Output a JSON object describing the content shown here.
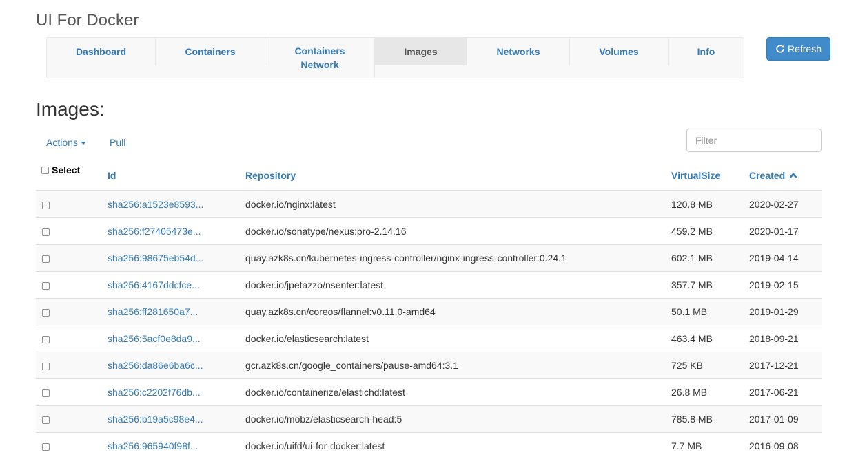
{
  "app_title": "UI For Docker",
  "nav": {
    "items": [
      {
        "label": "Dashboard"
      },
      {
        "label": "Containers"
      },
      {
        "label": "Containers Network"
      },
      {
        "label": "Images"
      },
      {
        "label": "Networks"
      },
      {
        "label": "Volumes"
      },
      {
        "label": "Info"
      }
    ],
    "active": "Images"
  },
  "refresh_label": "Refresh",
  "page_title": "Images:",
  "toolbar": {
    "actions_label": "Actions",
    "pull_label": "Pull",
    "filter_placeholder": "Filter"
  },
  "table": {
    "headers": {
      "select": "Select",
      "id": "Id",
      "repository": "Repository",
      "virtual_size": "VirtualSize",
      "created": "Created"
    },
    "sort_column": "Created",
    "rows": [
      {
        "id": "sha256:a1523e8593...",
        "repository": "docker.io/nginx:latest",
        "virtual_size": "120.8 MB",
        "created": "2020-02-27"
      },
      {
        "id": "sha256:f27405473e...",
        "repository": "docker.io/sonatype/nexus:pro-2.14.16",
        "virtual_size": "459.2 MB",
        "created": "2020-01-17"
      },
      {
        "id": "sha256:98675eb54d...",
        "repository": "quay.azk8s.cn/kubernetes-ingress-controller/nginx-ingress-controller:0.24.1",
        "virtual_size": "602.1 MB",
        "created": "2019-04-14"
      },
      {
        "id": "sha256:4167ddcfce...",
        "repository": "docker.io/jpetazzo/nsenter:latest",
        "virtual_size": "357.7 MB",
        "created": "2019-02-15"
      },
      {
        "id": "sha256:ff281650a7...",
        "repository": "quay.azk8s.cn/coreos/flannel:v0.11.0-amd64",
        "virtual_size": "50.1 MB",
        "created": "2019-01-29"
      },
      {
        "id": "sha256:5acf0e8da9...",
        "repository": "docker.io/elasticsearch:latest",
        "virtual_size": "463.4 MB",
        "created": "2018-09-21"
      },
      {
        "id": "sha256:da86e6ba6c...",
        "repository": "gcr.azk8s.cn/google_containers/pause-amd64:3.1",
        "virtual_size": "725 KB",
        "created": "2017-12-21"
      },
      {
        "id": "sha256:c2202f76db...",
        "repository": "docker.io/containerize/elastichd:latest",
        "virtual_size": "26.8 MB",
        "created": "2017-06-21"
      },
      {
        "id": "sha256:b19a5c98e4...",
        "repository": "docker.io/mobz/elasticsearch-head:5",
        "virtual_size": "785.8 MB",
        "created": "2017-01-09"
      },
      {
        "id": "sha256:965940f98f...",
        "repository": "docker.io/uifd/ui-for-docker:latest",
        "virtual_size": "7.7 MB",
        "created": "2016-09-08"
      }
    ]
  },
  "colors": {
    "link": "#337ab7",
    "primary_button": "#428bca",
    "nav_active_bg": "#e7e7e7",
    "row_stripe": "#f9f9f9"
  }
}
